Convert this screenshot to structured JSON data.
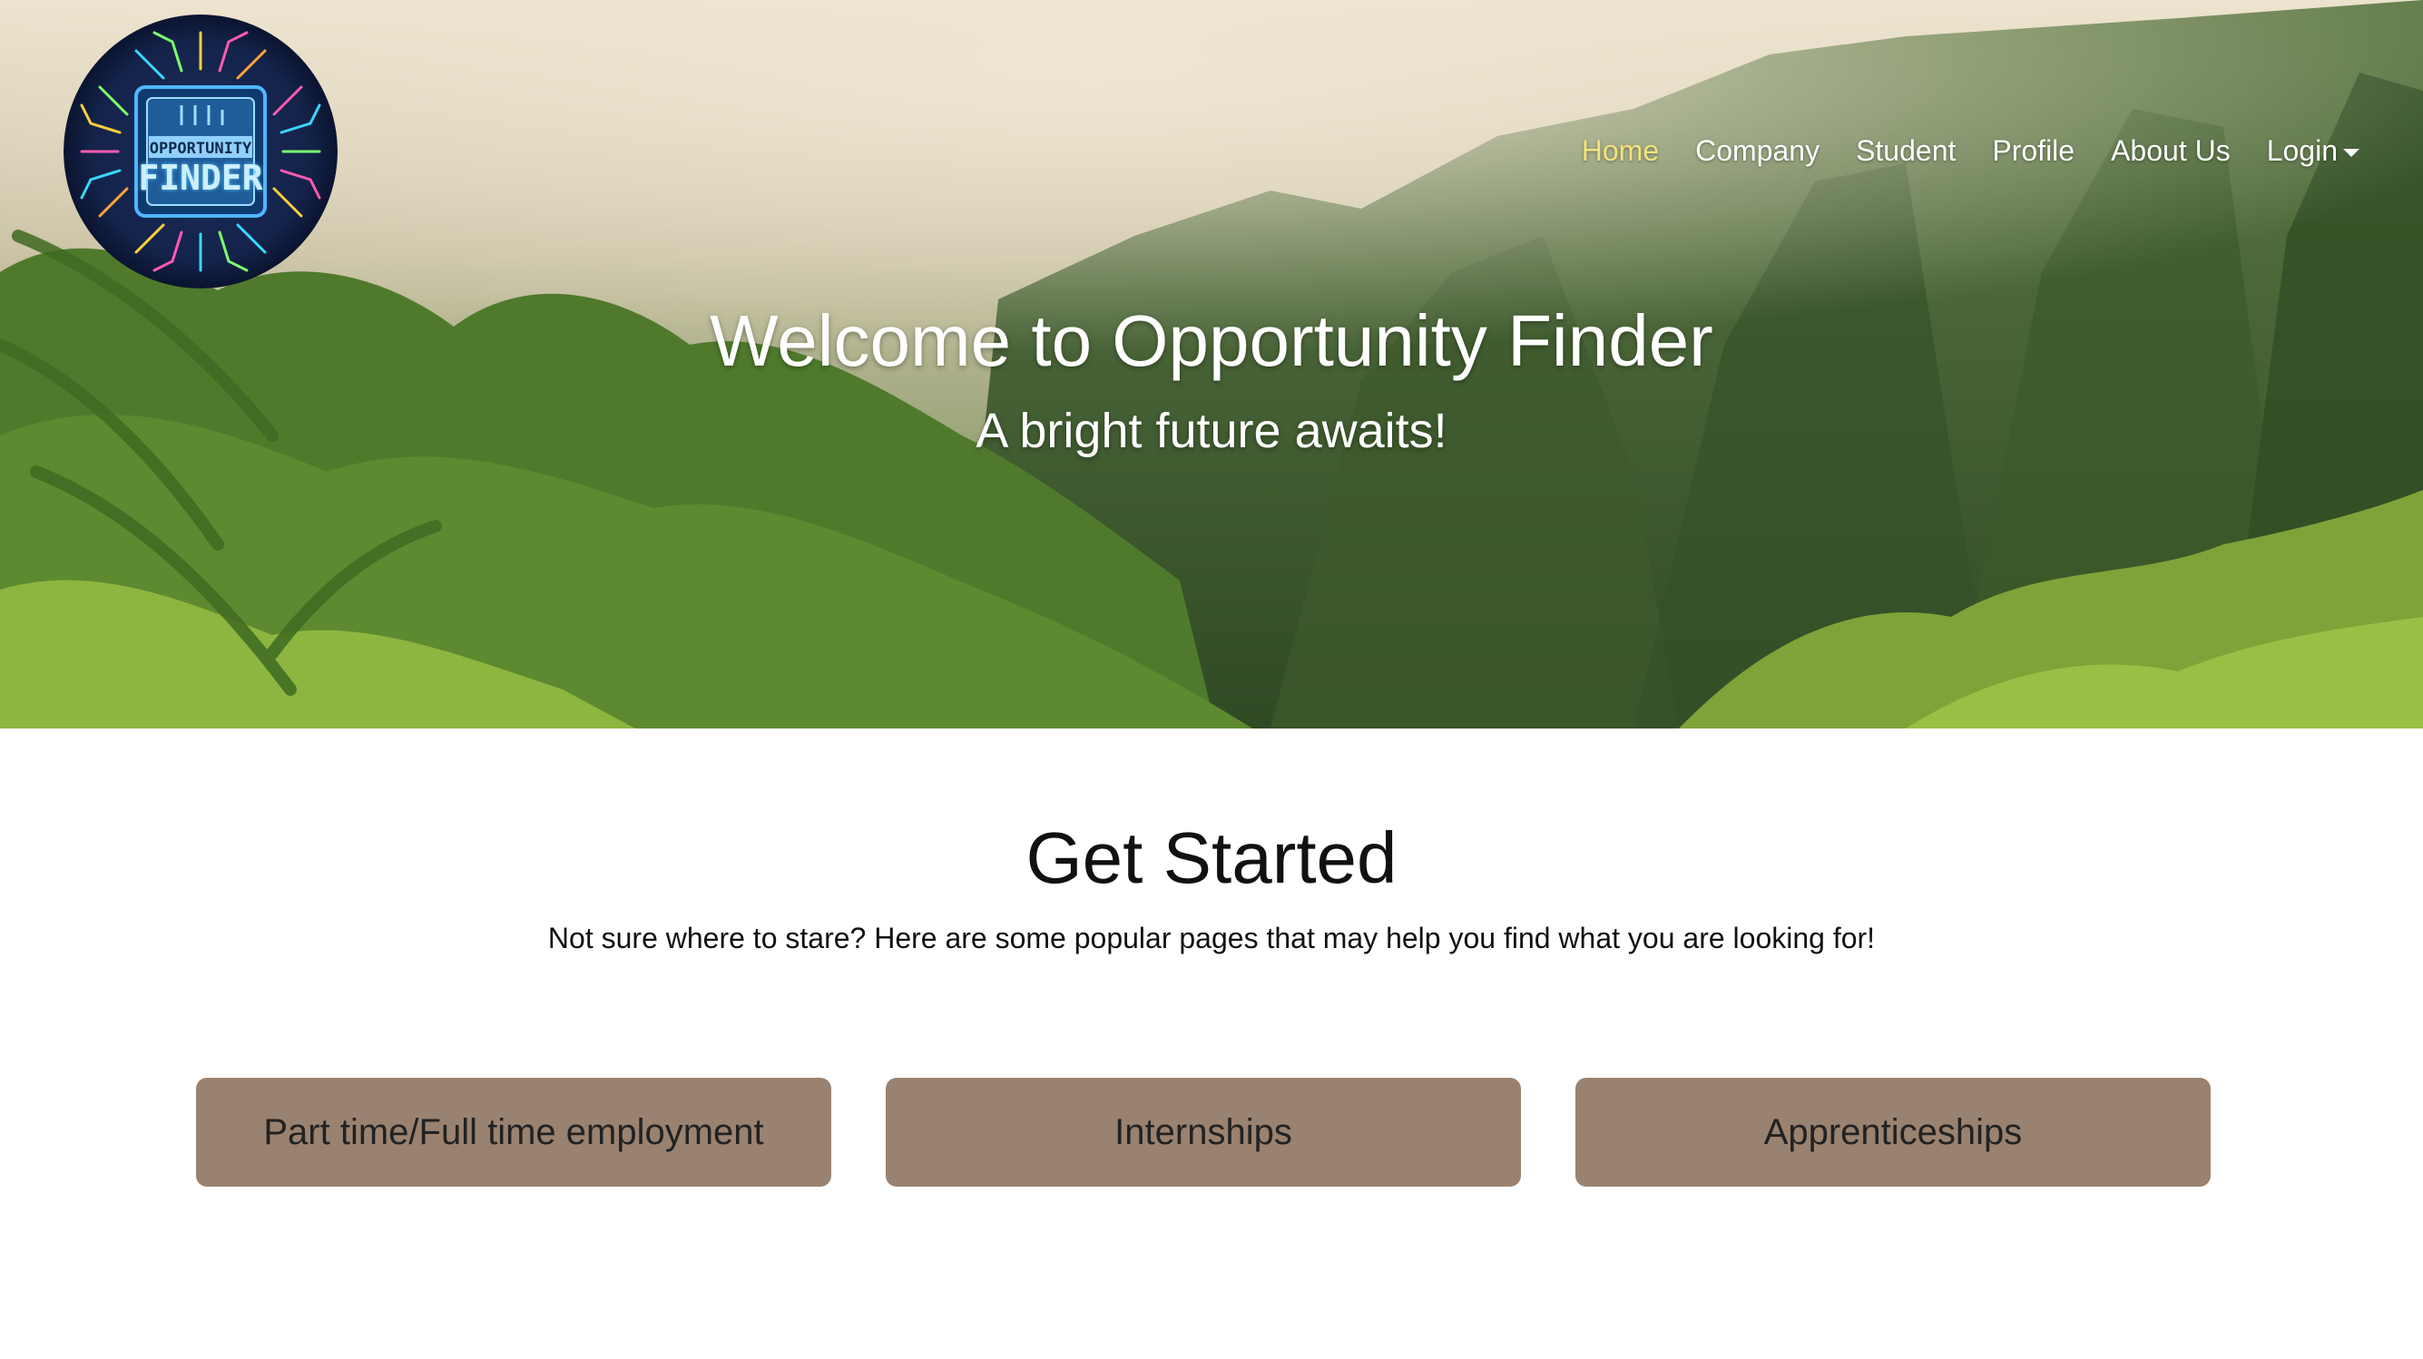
{
  "logo": {
    "line1": "OPPORTUNITY",
    "line2": "FINDER",
    "icon": "circuit-chip-logo"
  },
  "nav": {
    "items": [
      {
        "label": "Home",
        "active": true
      },
      {
        "label": "Company"
      },
      {
        "label": "Student"
      },
      {
        "label": "Profile"
      },
      {
        "label": "About Us"
      },
      {
        "label": "Login",
        "dropdown": true
      }
    ],
    "active_color": "#f3e27a"
  },
  "hero": {
    "title": "Welcome to Opportunity Finder",
    "subtitle": "A bright future awaits!"
  },
  "get_started": {
    "title": "Get Started",
    "text": "Not sure where to stare? Here are some popular pages that may help you find what you are looking for!",
    "buttons": [
      {
        "label": "Part time/Full time employment"
      },
      {
        "label": "Internships"
      },
      {
        "label": "Apprenticeships"
      }
    ],
    "button_color": "#9a8270"
  }
}
